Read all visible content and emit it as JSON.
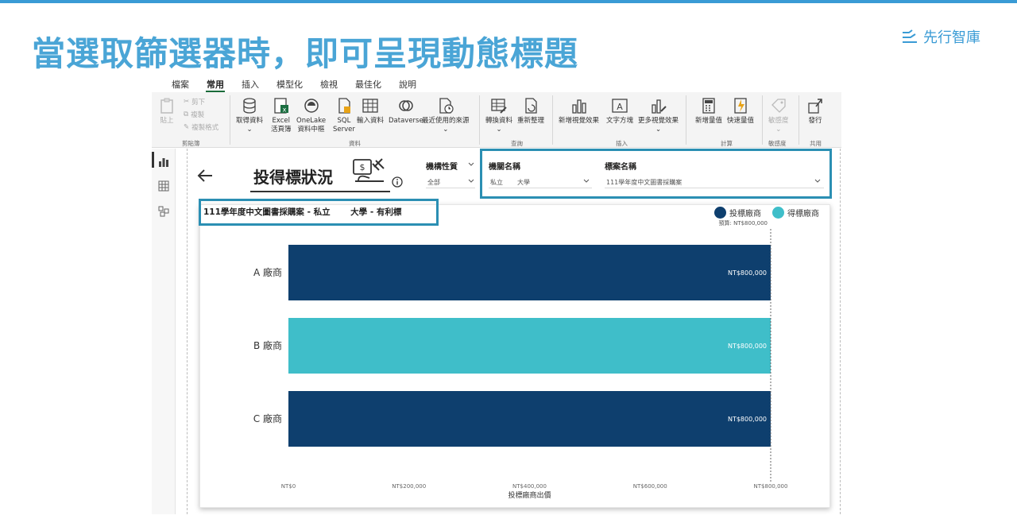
{
  "slide": {
    "title": "當選取篩選器時，即可呈現動態標題",
    "brand": "先行智庫"
  },
  "menu": {
    "items": [
      "檔案",
      "常用",
      "插入",
      "模型化",
      "檢視",
      "最佳化",
      "說明"
    ],
    "active": "常用"
  },
  "ribbon": {
    "paste": "貼上",
    "cut": "剪下",
    "copy": "複製",
    "format_painter": "複製格式",
    "group_clipboard": "剪貼簿",
    "get_data": "取得資料",
    "excel_1": "Excel",
    "excel_2": "活頁簿",
    "onelake_1": "OneLake",
    "onelake_2": "資料中樞",
    "sql_1": "SQL",
    "sql_2": "Server",
    "enter_data": "輸入資料",
    "dataverse": "Dataverse",
    "recent": "最近使用的來源",
    "group_data": "資料",
    "transform": "轉換資料",
    "refresh": "重新整理",
    "group_query": "查詢",
    "new_visual": "新增視覺效果",
    "text_box": "文字方塊",
    "more_visuals": "更多視覺效果",
    "group_insert": "插入",
    "new_measure": "新增量值",
    "quick_measure": "快速量值",
    "group_calc": "計算",
    "sensitivity": "敏感度",
    "group_sensitivity": "敏感度",
    "publish": "發行",
    "group_share": "共用"
  },
  "report": {
    "title": "投得標狀況"
  },
  "slicers": {
    "org_type": {
      "label": "機構性質",
      "value": "全部"
    },
    "org_name": {
      "label": "機關名稱",
      "prefix": "私立",
      "value": "大學"
    },
    "case_name": {
      "label": "標案名稱",
      "value": "111學年度中文圖書採購案"
    }
  },
  "card": {
    "title": "111學年度中文圖書採購案 - 私立       大學 - 有利標"
  },
  "colors": {
    "bid": "#0e3f6e",
    "win": "#3fbec9",
    "highlight": "#2b8fb3",
    "title": "#4aa5d6"
  },
  "chart_data": {
    "type": "bar",
    "orientation": "horizontal",
    "categories": [
      "A 廠商",
      "B 廠商",
      "C 廠商"
    ],
    "series": [
      {
        "name": "投標廠商",
        "values": [
          800000,
          null,
          800000
        ]
      },
      {
        "name": "得標廠商",
        "values": [
          null,
          800000,
          null
        ]
      }
    ],
    "data_labels": [
      "NT$800,000",
      "NT$800,000",
      "NT$800,000"
    ],
    "xlabel": "投標廠商出價",
    "x_ticks": [
      "NT$0",
      "NT$200,000",
      "NT$400,000",
      "NT$600,000",
      "NT$800,000"
    ],
    "xlim": [
      0,
      800000
    ],
    "reference_line": {
      "label": "預算: NT$800,000",
      "value": 800000
    },
    "legend": "top-right",
    "grid": false
  }
}
